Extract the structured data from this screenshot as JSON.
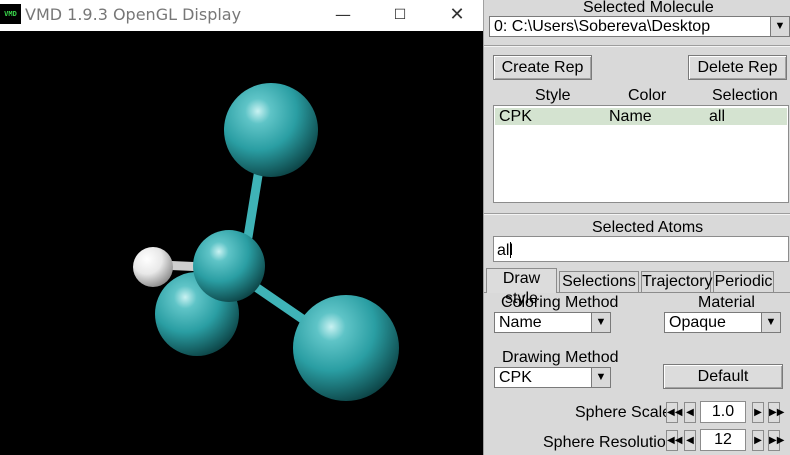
{
  "gl_window": {
    "app_icon_text": "VMD",
    "title": "VMD 1.9.3 OpenGL Display",
    "minimize_glyph": "—",
    "maximize_glyph": "☐",
    "close_glyph": "✕",
    "atoms": [
      {
        "element": "C",
        "color": "#2a9ea3"
      },
      {
        "element": "H",
        "color": "#ffffff"
      }
    ]
  },
  "panel": {
    "selected_molecule_label": "Selected Molecule",
    "selected_molecule_value": "0: C:\\Users\\Sobereva\\Desktop",
    "create_rep": "Create Rep",
    "delete_rep": "Delete Rep",
    "columns": {
      "style": "Style",
      "color": "Color",
      "selection": "Selection"
    },
    "reps": [
      {
        "style": "CPK",
        "color": "Name",
        "selection": "all"
      }
    ],
    "selected_atoms_label": "Selected Atoms",
    "selected_atoms_value": "all",
    "tabs": [
      "Draw style",
      "Selections",
      "Trajectory",
      "Periodic"
    ],
    "active_tab": "Draw style",
    "coloring_method_label": "Coloring Method",
    "coloring_method_value": "Name",
    "material_label": "Material",
    "material_value": "Opaque",
    "drawing_method_label": "Drawing Method",
    "drawing_method_value": "CPK",
    "default_button": "Default",
    "sphere_scale_label": "Sphere Scale",
    "sphere_scale_value": "1.0",
    "sphere_resolution_label": "Sphere Resolution",
    "sphere_resolution_value": "12"
  },
  "colors": {
    "selected_row": "#d4e3d0",
    "panel_bg": "#d9d9d9",
    "carbon": "#2a9ea3"
  }
}
